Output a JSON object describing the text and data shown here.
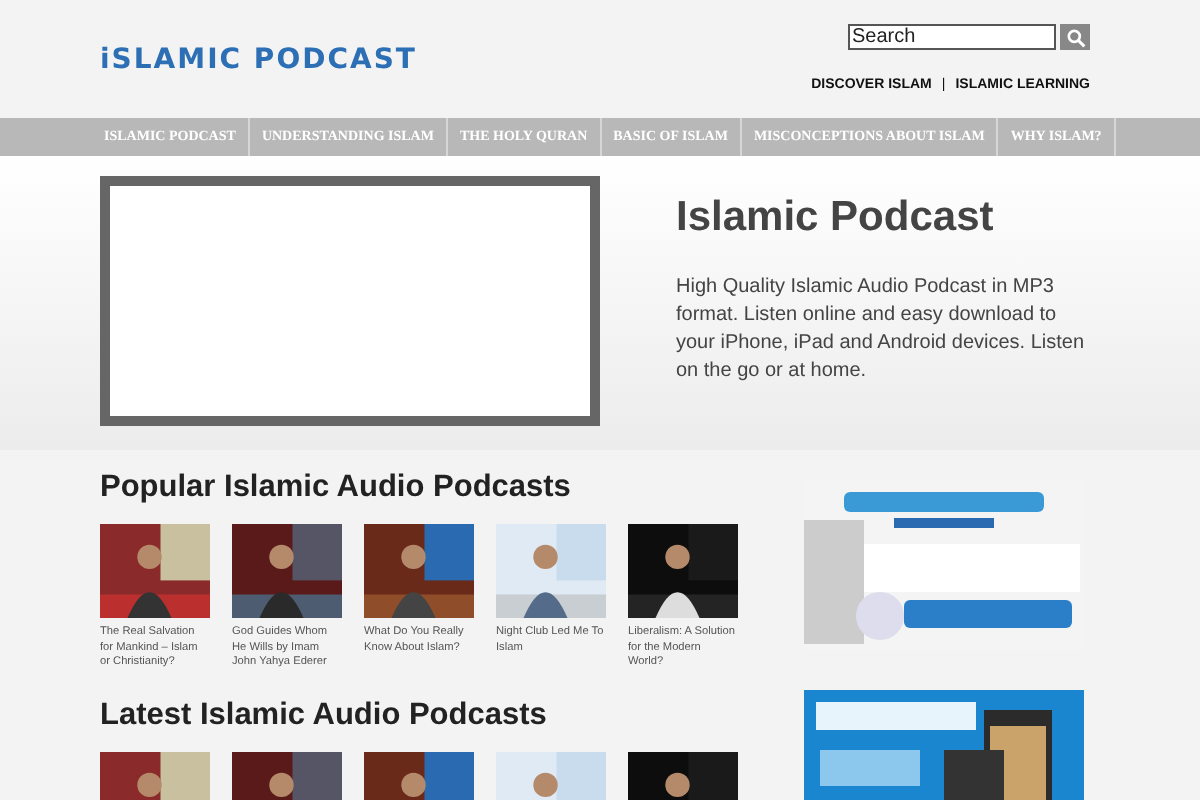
{
  "header": {
    "logo": "iSLAMIC PODCAST",
    "search": {
      "placeholder": "Search"
    },
    "links": [
      "DISCOVER ISLAM",
      "ISLAMIC LEARNING"
    ],
    "separator": "|"
  },
  "nav": [
    "ISLAMIC PODCAST",
    "UNDERSTANDING ISLAM",
    "THE HOLY QURAN",
    "BASIC OF ISLAM",
    "MISCONCEPTIONS ABOUT ISLAM",
    "WHY ISLAM?"
  ],
  "hero": {
    "title": "Islamic Podcast",
    "text": "High Quality Islamic Audio Podcast in MP3 format. Listen online and easy download to your iPhone, iPad and Android devices. Listen on the go or at home."
  },
  "sections": [
    {
      "title": "Popular Islamic Audio Podcasts",
      "items": [
        {
          "kind": "picture",
          "caption": "The Real Salvation for Mankind – Islam or Christianity?"
        },
        {
          "kind": "picture",
          "caption": "God Guides Whom He Wills by Imam John Yahya Ederer"
        },
        {
          "kind": "picture",
          "caption": "What Do You Really Know About Islam?"
        },
        {
          "kind": "picture",
          "caption": "Night Club Led Me To Islam"
        },
        {
          "kind": "picture",
          "caption": "Liberalism: A Solution for the Modern World?"
        }
      ]
    },
    {
      "title": "Latest Islamic Audio Podcasts"
    }
  ]
}
